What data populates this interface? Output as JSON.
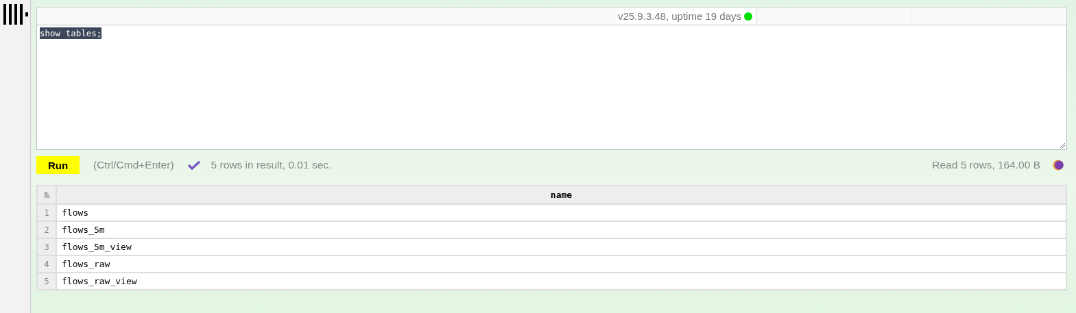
{
  "connection": {
    "status_text": "v25.9.3.48, uptime 19 days",
    "online": true
  },
  "editor": {
    "query": "show tables;",
    "selected": true
  },
  "run_bar": {
    "button": "Run",
    "hint": "(Ctrl/Cmd+Enter)",
    "success": true,
    "result_info": "5 rows in result, 0.01 sec.",
    "read_info": "Read 5 rows, 164.00 B"
  },
  "table": {
    "columns": [
      "№",
      "name"
    ],
    "rows": [
      [
        "1",
        "flows"
      ],
      [
        "2",
        "flows_5m"
      ],
      [
        "3",
        "flows_5m_view"
      ],
      [
        "4",
        "flows_raw"
      ],
      [
        "5",
        "flows_raw_view"
      ]
    ]
  }
}
